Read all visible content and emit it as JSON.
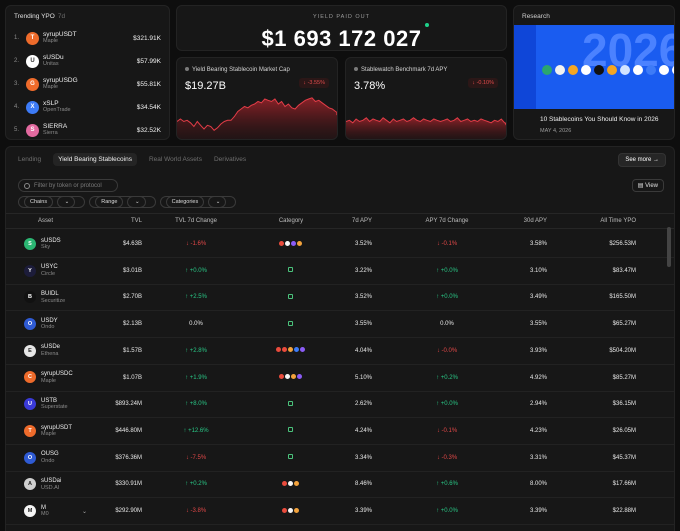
{
  "trending": {
    "title": "Trending YPO",
    "period": "7d",
    "items": [
      {
        "rank": "1.",
        "name": "syrupUSDT",
        "sub": "Maple",
        "value": "$321.91K",
        "color": "#ee6b2b",
        "glyph": "T"
      },
      {
        "rank": "2.",
        "name": "sUSDu",
        "sub": "Unitas",
        "value": "$57.99K",
        "color": "#ffffff",
        "glyph": "U"
      },
      {
        "rank": "3.",
        "name": "syrupUSDG",
        "sub": "Maple",
        "value": "$55.81K",
        "color": "#ee6b2b",
        "glyph": "G"
      },
      {
        "rank": "4.",
        "name": "xSLP",
        "sub": "OpenTrade",
        "value": "$34.54K",
        "color": "#3d7bf7",
        "glyph": "X"
      },
      {
        "rank": "5.",
        "name": "SIERRA",
        "sub": "Sierra",
        "value": "$32.52K",
        "color": "#e36aa0",
        "glyph": "S"
      }
    ]
  },
  "yield_paid": {
    "label": "YIELD PAID OUT",
    "value": "$1 693 172 027"
  },
  "market_cap": {
    "title": "Yield Bearing Stablecoin Market Cap",
    "value": "$19.27B",
    "change": "-3.55%",
    "line": [
      44,
      46,
      44,
      45,
      43,
      40,
      44,
      41,
      38,
      41,
      40,
      37,
      39,
      42,
      44,
      45,
      45,
      48,
      52,
      54,
      56,
      55,
      57,
      58,
      60,
      59,
      62,
      61,
      60,
      62,
      58,
      60,
      56,
      58,
      55,
      54,
      57,
      59,
      61,
      62,
      63,
      60,
      61,
      59,
      57,
      55,
      54,
      52,
      50
    ]
  },
  "benchmark": {
    "title": "Stablewatch Benchmark 7d APY",
    "value": "3.78%",
    "change": "-0.10%",
    "line": [
      44,
      45,
      43,
      46,
      44,
      45,
      47,
      44,
      46,
      45,
      44,
      47,
      45,
      43,
      46,
      44,
      45,
      46,
      44,
      45,
      47,
      45,
      44,
      46,
      45,
      44,
      46,
      45,
      44,
      45,
      46,
      44,
      45,
      47,
      44,
      45,
      46,
      44,
      45,
      44,
      46,
      45,
      44,
      43,
      45,
      44,
      46,
      43,
      42
    ]
  },
  "research": {
    "title": "Research",
    "image_text": "2026",
    "article": "10 Stablecoins You Should Know in 2026",
    "date": "MAY 4, 2026",
    "chips": [
      "#2aa66f",
      "#f2f2f2",
      "#f5a623",
      "#ffffff",
      "#111111",
      "#f5a623",
      "#d2e4ff",
      "#ffffff",
      "#3d7bf7",
      "#ffffff",
      "#ffffff",
      "#ffffff"
    ]
  },
  "tabs": [
    "Lending",
    "Yield Bearing Stablecoins",
    "Real World Assets",
    "Derivatives"
  ],
  "see_more": "See more",
  "search_placeholder": "Filter by token or protocol",
  "view_label": "View",
  "filters": [
    "Chains",
    "Range",
    "Categories"
  ],
  "columns": [
    "Asset",
    "TVL",
    "TVL 7d Change",
    "Category",
    "7d APY",
    "APY 7d Change",
    "30d APY",
    "All Time YPO"
  ],
  "rows": [
    {
      "name": "sUSDS",
      "sub": "Sky",
      "color": "#2bb673",
      "glyph": "S",
      "tvl": "$4.63B",
      "tvl_chg": "-1.6%",
      "tvl_dir": "dn",
      "cats": [
        "#e94b3c",
        "#f5f5f5",
        "#8b5cf6",
        "#f2a23c"
      ],
      "apy7": "3.52%",
      "apy_chg": "-0.1%",
      "apy_dir": "dn",
      "apy30": "3.58%",
      "ypo": "$256.53M"
    },
    {
      "name": "USYC",
      "sub": "Circle",
      "color": "#1c1c3a",
      "glyph": "Y",
      "tvl": "$3.01B",
      "tvl_chg": "+0.0%",
      "tvl_dir": "up",
      "cats": [
        "sq"
      ],
      "apy7": "3.22%",
      "apy_chg": "+0.0%",
      "apy_dir": "up",
      "apy30": "3.10%",
      "ypo": "$83.47M"
    },
    {
      "name": "BUIDL",
      "sub": "Securitize",
      "color": "#111111",
      "glyph": "B",
      "tvl": "$2.70B",
      "tvl_chg": "+2.5%",
      "tvl_dir": "up",
      "cats": [
        "sq"
      ],
      "apy7": "3.52%",
      "apy_chg": "+0.0%",
      "apy_dir": "up",
      "apy30": "3.49%",
      "ypo": "$165.50M"
    },
    {
      "name": "USDY",
      "sub": "Ondo",
      "color": "#2f5bd4",
      "glyph": "O",
      "tvl": "$2.13B",
      "tvl_chg": "0.0%",
      "tvl_dir": "nt",
      "cats": [
        "sq"
      ],
      "apy7": "3.55%",
      "apy_chg": "0.0%",
      "apy_dir": "nt",
      "apy30": "3.55%",
      "ypo": "$65.27M"
    },
    {
      "name": "sUSDe",
      "sub": "Ethena",
      "color": "#e6e6e6",
      "glyph": "E",
      "tvl": "$1.57B",
      "tvl_chg": "+2.8%",
      "tvl_dir": "up",
      "cats": [
        "#e94b3c",
        "#e94b3c",
        "#f2a23c",
        "#3d7bf7",
        "#8b5cf6"
      ],
      "apy7": "4.04%",
      "apy_chg": "-0.0%",
      "apy_dir": "dn",
      "apy30": "3.93%",
      "ypo": "$504.20M"
    },
    {
      "name": "syrupUSDC",
      "sub": "Maple",
      "color": "#ee6b2b",
      "glyph": "C",
      "tvl": "$1.07B",
      "tvl_chg": "+1.9%",
      "tvl_dir": "up",
      "cats": [
        "#e94b3c",
        "#f5f5f5",
        "#f2a23c",
        "#8b5cf6"
      ],
      "apy7": "5.10%",
      "apy_chg": "+0.2%",
      "apy_dir": "up",
      "apy30": "4.92%",
      "ypo": "$85.27M"
    },
    {
      "name": "USTB",
      "sub": "Superstate",
      "color": "#3a3ad8",
      "glyph": "U",
      "tvl": "$893.24M",
      "tvl_chg": "+8.0%",
      "tvl_dir": "up",
      "cats": [
        "sq"
      ],
      "apy7": "2.62%",
      "apy_chg": "+0.0%",
      "apy_dir": "up",
      "apy30": "2.94%",
      "ypo": "$36.15M"
    },
    {
      "name": "syrupUSDT",
      "sub": "Maple",
      "color": "#ee6b2b",
      "glyph": "T",
      "tvl": "$446.80M",
      "tvl_chg": "+12.6%",
      "tvl_dir": "up",
      "cats": [
        "sq"
      ],
      "apy7": "4.24%",
      "apy_chg": "-0.1%",
      "apy_dir": "dn",
      "apy30": "4.23%",
      "ypo": "$26.05M"
    },
    {
      "name": "OUSG",
      "sub": "Ondo",
      "color": "#2f5bd4",
      "glyph": "O",
      "tvl": "$376.36M",
      "tvl_chg": "-7.5%",
      "tvl_dir": "dn",
      "cats": [
        "sq"
      ],
      "apy7": "3.34%",
      "apy_chg": "-0.3%",
      "apy_dir": "dn",
      "apy30": "3.31%",
      "ypo": "$45.37M"
    },
    {
      "name": "sUSDai",
      "sub": "USD.AI",
      "color": "#cfcfcf",
      "glyph": "A",
      "tvl": "$330.91M",
      "tvl_chg": "+0.2%",
      "tvl_dir": "up",
      "cats": [
        "#e94b3c",
        "#f5f5f5",
        "#f2a23c"
      ],
      "apy7": "8.46%",
      "apy_chg": "+0.6%",
      "apy_dir": "up",
      "apy30": "8.00%",
      "ypo": "$17.66M"
    },
    {
      "name": "M",
      "sub": "M0",
      "color": "#f5f5f5",
      "glyph": "M",
      "tvl": "$292.90M",
      "tvl_chg": "-3.8%",
      "tvl_dir": "dn",
      "cats": [
        "#e94b3c",
        "#f5f5f5",
        "#f2a23c"
      ],
      "apy7": "3.39%",
      "apy_chg": "+0.0%",
      "apy_dir": "up",
      "apy30": "3.39%",
      "ypo": "$22.88M"
    }
  ]
}
